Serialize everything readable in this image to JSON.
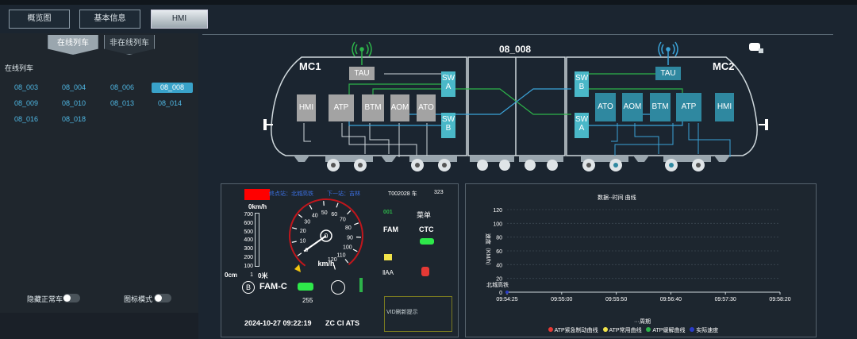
{
  "tabs": [
    {
      "label": "概览图",
      "active": false
    },
    {
      "label": "基本信息",
      "active": false
    },
    {
      "label": "HMI",
      "active": true
    }
  ],
  "left": {
    "subtabs": [
      {
        "label": "在线列车",
        "active": true
      },
      {
        "label": "非在线列车",
        "active": false
      }
    ],
    "section_title": "在线列车",
    "trains": [
      "08_003",
      "08_004",
      "08_006",
      "08_008",
      "08_009",
      "08_010",
      "08_013",
      "08_014",
      "08_016",
      "08_018"
    ],
    "selected_train": "08_008",
    "toggles": [
      {
        "label": "隐藏正常车",
        "on": false
      },
      {
        "label": "图标模式",
        "on": false
      }
    ]
  },
  "train_diagram": {
    "title": "08_008",
    "car_left": "MC1",
    "car_right": "MC2",
    "left_units": {
      "hmi": "HMI",
      "atp": "ATP",
      "btm": "BTM",
      "aom": "AOM",
      "ato": "ATO",
      "tau": "TAU",
      "swa_l1": "SW",
      "swa_l2": "A",
      "swb_l1": "SW",
      "swb_l2": "B"
    },
    "right_units": {
      "hmi": "HMI",
      "atp": "ATP",
      "btm": "BTM",
      "aom": "AOM",
      "ato": "ATO",
      "tau": "TAU",
      "swb_l1": "SW",
      "swb_l2": "B",
      "swa_l1": "SW",
      "swa_l2": "A"
    },
    "colors": {
      "left_unit": "#a3a3a3",
      "right_unit": "#2f88a0",
      "switch": "#4ab8c8",
      "line_green": "#2db34a",
      "line_blue": "#3ba3d8"
    }
  },
  "hmi": {
    "terminal": "终点站：北城高铁",
    "next_station": "下一站：吉林",
    "train_info": "T002028 车",
    "train_num": "323",
    "speed_left": "0km/h",
    "bar_ticks": [
      "700",
      "600",
      "500",
      "400",
      "300",
      "200",
      "100",
      "1"
    ],
    "dist_left": "0cm",
    "dist_right": "0米",
    "speed_unit": "km/h",
    "gauge_needle_kmh": 0,
    "gauge_ticks": [
      "0",
      "10",
      "20",
      "30",
      "40",
      "50",
      "60",
      "70",
      "80",
      "90",
      "100",
      "110",
      "120"
    ],
    "gauge_center": "0",
    "code_green": "001",
    "mode_menu": "菜单",
    "fam": "FAM",
    "ctc": "CTC",
    "aa": "‖AA",
    "fam_c": "FAM-C",
    "b_icon": "B",
    "count": "255",
    "datetime": "2024-10-27 09:22:19",
    "zc_ci_ats": "ZC CI ATS",
    "vid_box": "VID刷新提示"
  },
  "chart_panel": {
    "top_title": "数据--时间 曲线",
    "sub_label": "北城高铁",
    "legend_title": "···周期",
    "legend": [
      {
        "label": "ATP紧急制动曲线",
        "color": "#e53935"
      },
      {
        "label": "ATP常用曲线",
        "color": "#f1e34a"
      },
      {
        "label": "ATP缓解曲线",
        "color": "#2db34a"
      },
      {
        "label": "实际速度",
        "color": "#2a3cc9"
      }
    ]
  },
  "chart_data": {
    "type": "line",
    "ylabel": "速度（KM/h）",
    "ylim": [
      0,
      120
    ],
    "yticks": [
      "0",
      "20",
      "40",
      "60",
      "80",
      "100",
      "120"
    ],
    "x": [
      "09:54:25",
      "09:55:00",
      "09:55:50",
      "09:56:40",
      "09:57:30",
      "09:58:20"
    ],
    "grid": true,
    "series": [
      {
        "name": "实际速度",
        "values": [
          0
        ]
      }
    ]
  }
}
